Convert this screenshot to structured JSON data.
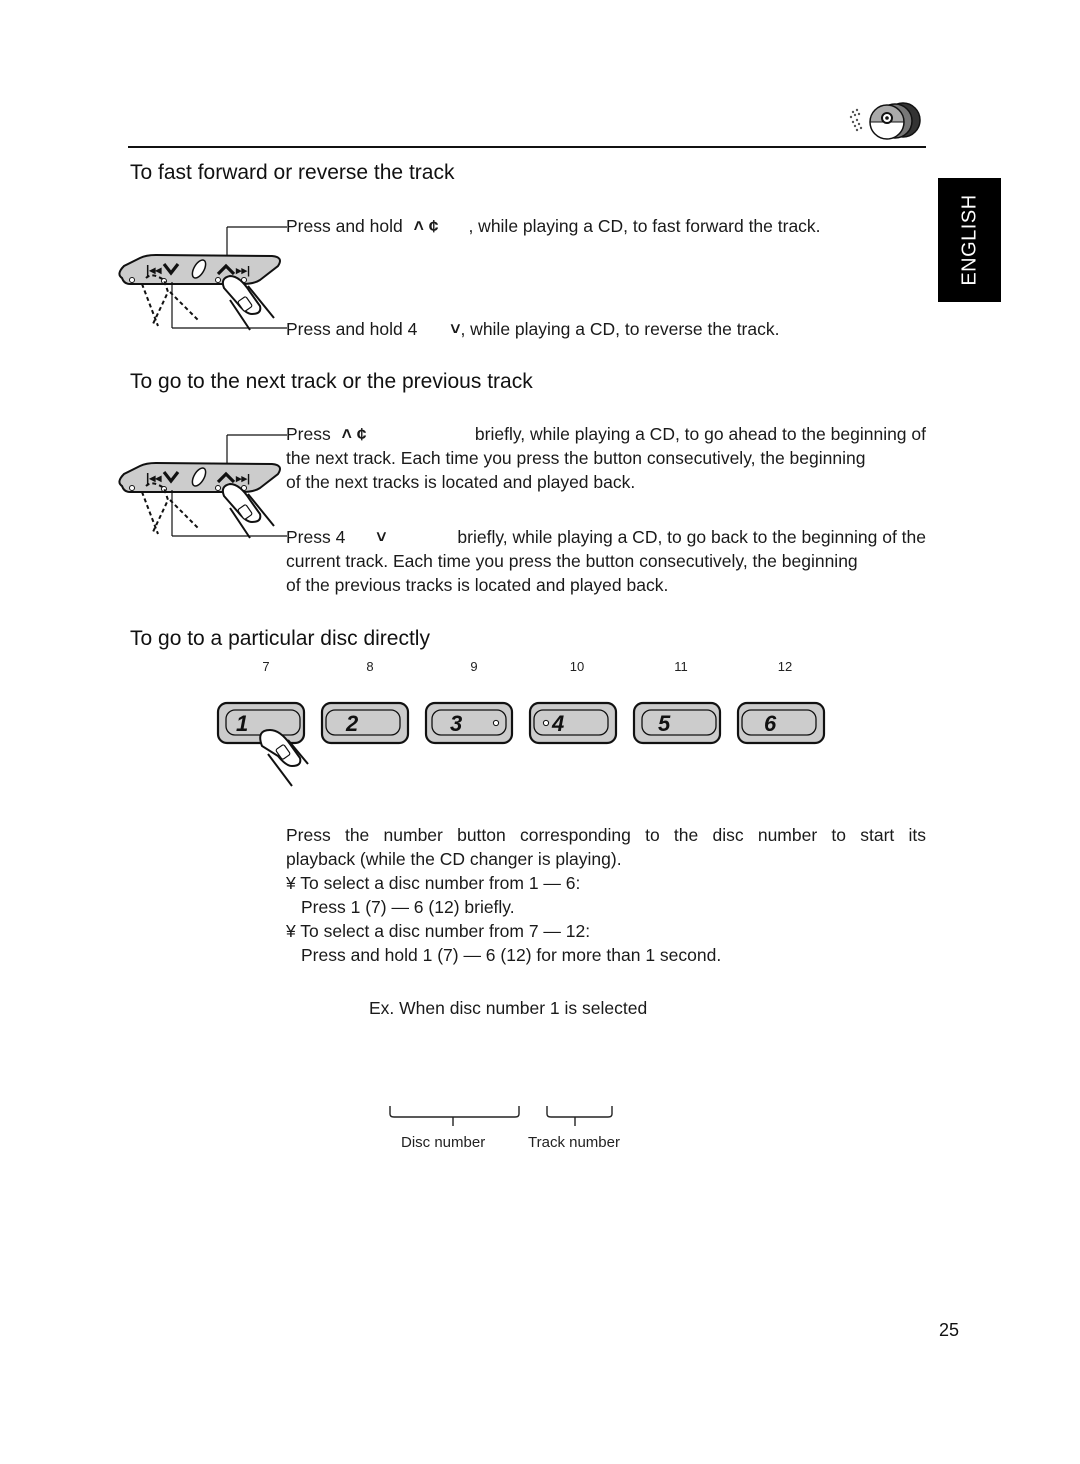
{
  "header": {
    "icon": "cd-changer-discs-icon",
    "language_tab": "ENGLISH"
  },
  "sections": {
    "fast_forward": {
      "title": "To fast forward or reverse the track",
      "line1_prefix": "Press and hold",
      "line1_symbol": "˄ ¢",
      "line1_suffix": ", while playing a CD, to fast forward the track.",
      "line2_prefix": "Press and hold 4",
      "line2_symbol": "˅",
      "line2_suffix": ", while playing a CD, to reverse the track."
    },
    "next_prev": {
      "title": "To go to the next track or the previous track",
      "para1_prefix": "Press",
      "para1_symbol": "˄ ¢",
      "para1_line1": "briefly, while playing a CD, to go ahead to the beginning of",
      "para1_line2": "the next track. Each time you press the button consecutively, the beginning",
      "para1_line3": "of the next tracks is located and played back.",
      "para2_prefix": "Press 4",
      "para2_symbol": "˅",
      "para2_line1": "briefly, while playing a CD, to go back to the beginning of the",
      "para2_line2": "current track. Each time you press the button consecutively, the beginning",
      "para2_line3": "of the previous tracks is located and played back."
    },
    "disc_direct": {
      "title": "To go to a particular disc directly",
      "secondary_numbers": [
        "7",
        "8",
        "9",
        "10",
        "11",
        "12"
      ],
      "buttons": [
        "1",
        "2",
        "3",
        "4",
        "5",
        "6"
      ],
      "intro_line1": "Press the number button corresponding to the disc number to start its",
      "intro_line2": "playback (while the CD changer is playing).",
      "bullet_char": "¥",
      "bullet1": "To select a disc number from 1 — 6:",
      "bullet1_detail": "Press 1 (7) — 6 (12) briefly.",
      "bullet2": "To select a disc number from 7 — 12:",
      "bullet2_detail": "Press and hold 1 (7) — 6 (12) for more than 1 second.",
      "example": "Ex. When disc number 1 is selected",
      "label_disc": "Disc number",
      "label_track": "Track number"
    }
  },
  "footer": {
    "page_number": "25"
  }
}
